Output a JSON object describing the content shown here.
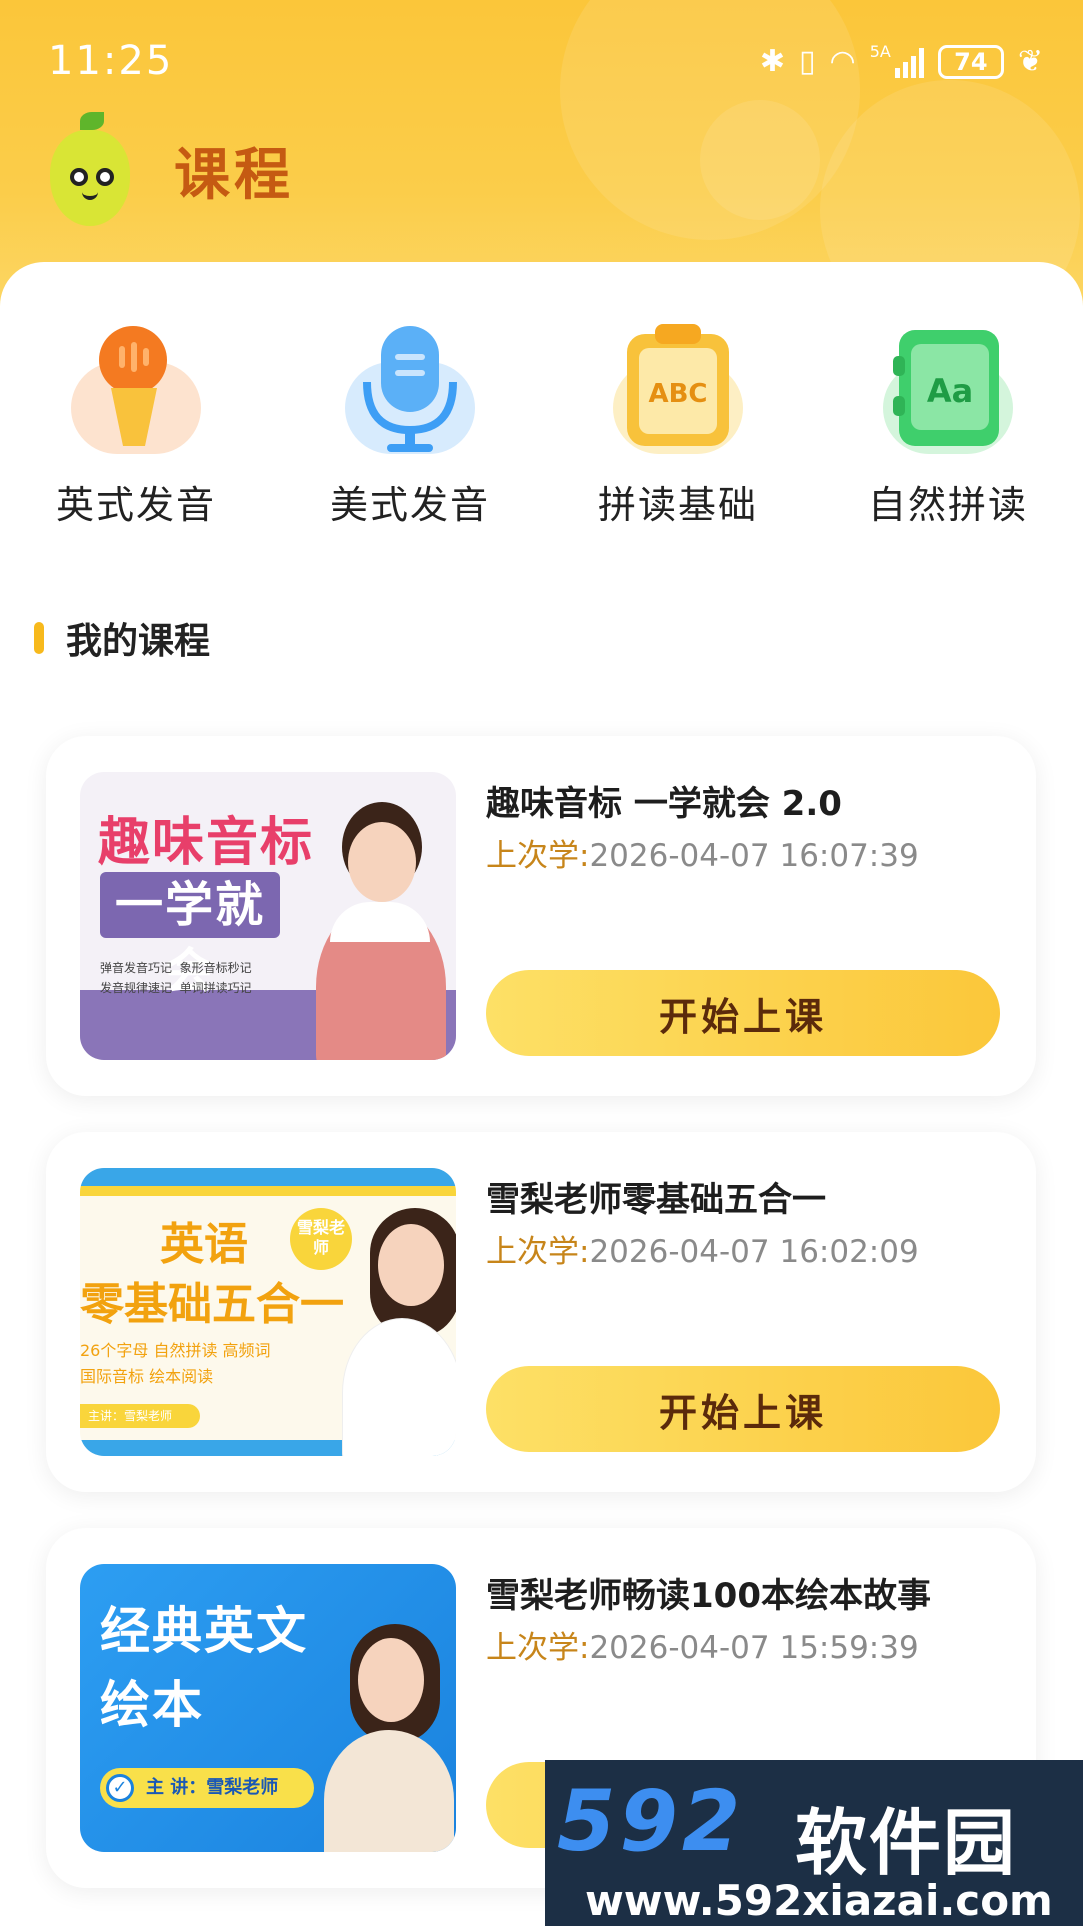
{
  "status_bar": {
    "time": "11:25",
    "network": "5A",
    "battery": "74"
  },
  "header": {
    "title": "课程"
  },
  "categories": [
    {
      "label": "英式发音",
      "icon": "mic-icon",
      "color": "#f47a21"
    },
    {
      "label": "美式发音",
      "icon": "microphone-icon",
      "color": "#3d9ef5"
    },
    {
      "label": "拼读基础",
      "icon": "abc-board-icon",
      "color": "#f8c23b"
    },
    {
      "label": "自然拼读",
      "icon": "aa-book-icon",
      "color": "#3fcf6c"
    }
  ],
  "my_courses": {
    "title": "我的课程",
    "last_label": "上次学:",
    "start_label": "开始上课",
    "items": [
      {
        "name": "趣味音标 一学就会 2.0",
        "last_time": "2026-04-07 16:07:39",
        "thumb": {
          "headline": "趣味音标",
          "subhead": "一学就会",
          "bullets": [
            "弹音发音巧记",
            "象形音标秒记",
            "发音规律速记",
            "单词拼读巧记"
          ]
        }
      },
      {
        "name": "雪梨老师零基础五合一",
        "last_time": "2026-04-07 16:02:09",
        "thumb": {
          "headline": "英语",
          "subhead": "零基础五合一",
          "badge": "雪梨老师",
          "features": [
            "26个字母  自然拼读  高频词",
            "国际音标  绘本阅读"
          ],
          "host": "主讲：雪梨老师"
        }
      },
      {
        "name": "雪梨老师畅读100本绘本故事",
        "last_time": "2026-04-07 15:59:39",
        "thumb": {
          "headline": "经典英文",
          "subhead": "绘本",
          "host": "主 讲：雪梨老师"
        }
      }
    ]
  },
  "watermark": {
    "number": "592",
    "brand": "软件园",
    "url": "www.592xiazai.com"
  }
}
